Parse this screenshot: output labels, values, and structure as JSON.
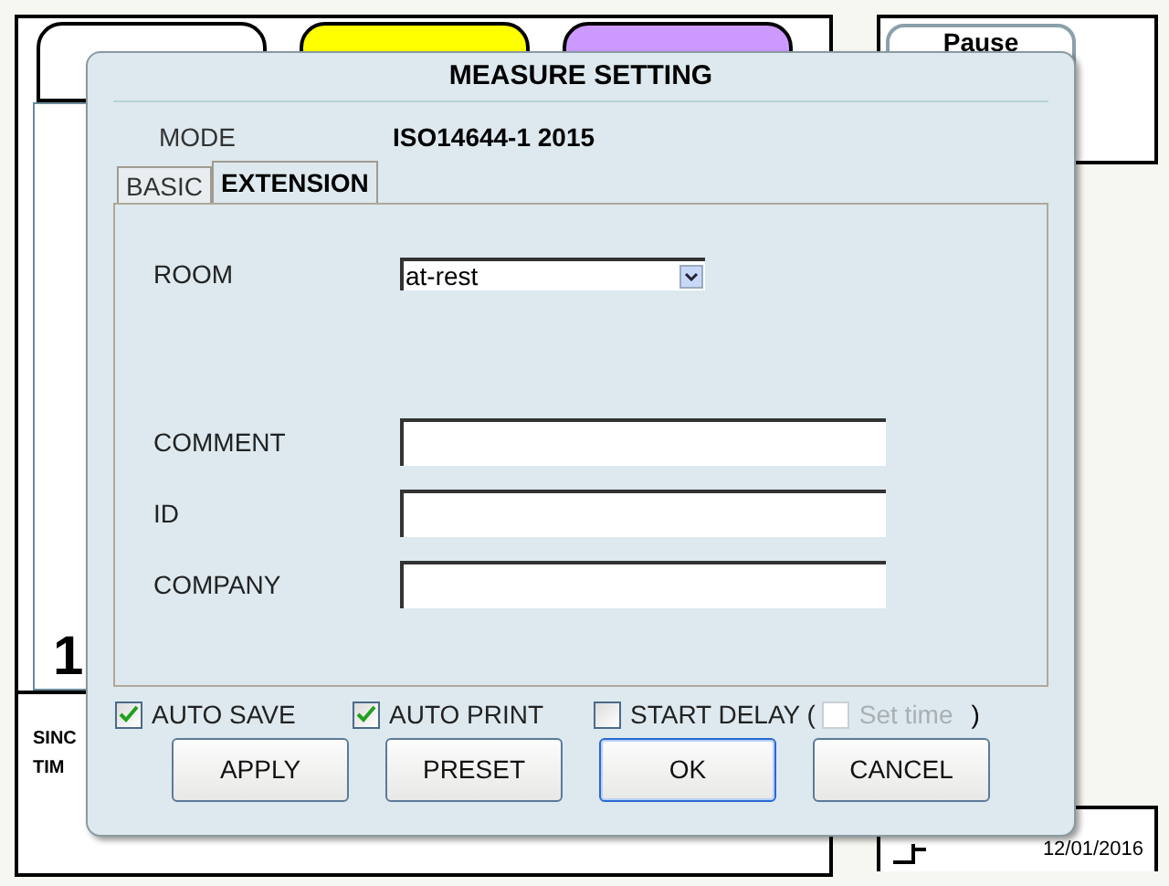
{
  "background": {
    "tabs": [
      {
        "color": "#ffffff"
      },
      {
        "color": "#ffff00"
      },
      {
        "color": "#cc99ff"
      }
    ],
    "pause_button": "Pause",
    "counter": "1",
    "info_labels": [
      "SINC",
      "TIM"
    ],
    "date": "12/01/2016"
  },
  "dialog": {
    "title": "MEASURE SETTING",
    "mode_label": "MODE",
    "mode_value": "ISO14644-1 2015",
    "tabs": [
      {
        "label": "BASIC",
        "selected": false
      },
      {
        "label": "EXTENSION",
        "selected": true
      }
    ],
    "fields": [
      {
        "kind": "select",
        "label": "ROOM",
        "value": "at-rest"
      },
      {
        "kind": "text",
        "label": "COMMENT"
      },
      {
        "kind": "text",
        "label": "ID"
      },
      {
        "kind": "text",
        "label": "COMPANY"
      }
    ],
    "options": [
      {
        "label": "AUTO SAVE",
        "checked": true,
        "disabled": false
      },
      {
        "label": "AUTO PRINT",
        "checked": true,
        "disabled": false
      },
      {
        "label": "START DELAY (",
        "checked": false,
        "disabled": false
      },
      {
        "label": "Set time",
        "checked": false,
        "disabled": true
      }
    ],
    "delay_close": ")",
    "buttons": [
      {
        "label": "APPLY",
        "default": false
      },
      {
        "label": "PRESET",
        "default": false
      },
      {
        "label": "OK",
        "default": true
      },
      {
        "label": "CANCEL",
        "default": false
      }
    ]
  }
}
